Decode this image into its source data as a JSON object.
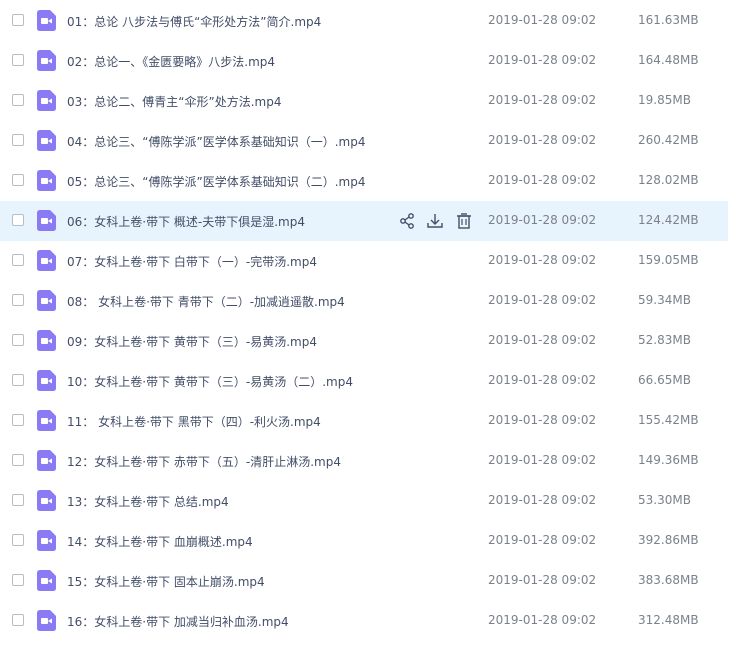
{
  "files": [
    {
      "name": "01：总论 八步法与傅氏“伞形处方法”简介.mp4",
      "date": "2019-01-28 09:02",
      "size": "161.63MB"
    },
    {
      "name": "02：总论一、《金匮要略》八步法.mp4",
      "date": "2019-01-28 09:02",
      "size": "164.48MB"
    },
    {
      "name": "03：总论二、傅青主“伞形”处方法.mp4",
      "date": "2019-01-28 09:02",
      "size": "19.85MB"
    },
    {
      "name": "04：总论三、“傅陈学派”医学体系基础知识（一）.mp4",
      "date": "2019-01-28 09:02",
      "size": "260.42MB"
    },
    {
      "name": "05：总论三、“傅陈学派”医学体系基础知识（二）.mp4",
      "date": "2019-01-28 09:02",
      "size": "128.02MB"
    },
    {
      "name": "06：女科上卷·带下 概述-夫带下俱是湿.mp4",
      "date": "2019-01-28 09:02",
      "size": "124.42MB"
    },
    {
      "name": "07：女科上卷·带下 白带下（一）-完带汤.mp4",
      "date": "2019-01-28 09:02",
      "size": "159.05MB"
    },
    {
      "name": "08： 女科上卷·带下 青带下（二）-加减逍遥散.mp4",
      "date": "2019-01-28 09:02",
      "size": "59.34MB"
    },
    {
      "name": "09：女科上卷·带下 黄带下（三）-易黄汤.mp4",
      "date": "2019-01-28 09:02",
      "size": "52.83MB"
    },
    {
      "name": "10：女科上卷·带下 黄带下（三）-易黄汤（二）.mp4",
      "date": "2019-01-28 09:02",
      "size": "66.65MB"
    },
    {
      "name": "11： 女科上卷·带下 黑带下（四）-利火汤.mp4",
      "date": "2019-01-28 09:02",
      "size": "155.42MB"
    },
    {
      "name": "12：女科上卷·带下 赤带下（五）-清肝止淋汤.mp4",
      "date": "2019-01-28 09:02",
      "size": "149.36MB"
    },
    {
      "name": "13：女科上卷·带下 总结.mp4",
      "date": "2019-01-28 09:02",
      "size": "53.30MB"
    },
    {
      "name": "14：女科上卷·带下 血崩概述.mp4",
      "date": "2019-01-28 09:02",
      "size": "392.86MB"
    },
    {
      "name": "15：女科上卷·带下 固本止崩汤.mp4",
      "date": "2019-01-28 09:02",
      "size": "383.68MB"
    },
    {
      "name": "16：女科上卷·带下 加减当归补血汤.mp4",
      "date": "2019-01-28 09:02",
      "size": "312.48MB"
    }
  ],
  "hovered_row": 6,
  "row_actions": [
    "share-icon",
    "download-icon",
    "delete-icon"
  ],
  "icons": {
    "file": "video-file-icon"
  },
  "colors": {
    "icon": "#8a7bf5",
    "hover_row": "#e8f4fd",
    "text": "#424e67",
    "meta": "#7b818c"
  }
}
